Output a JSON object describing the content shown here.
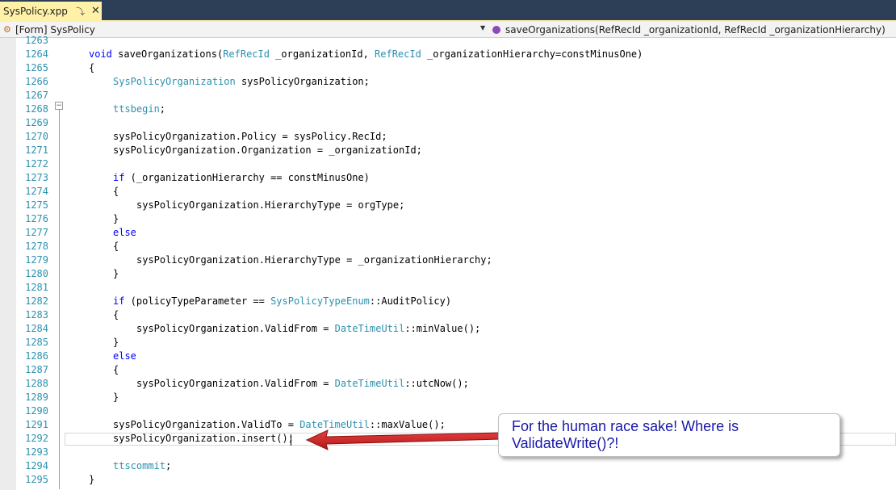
{
  "tab": {
    "title": "SysPolicy.xpp",
    "pin_glyph": "⤵",
    "close_glyph": "✕"
  },
  "navbar": {
    "left_label": "[Form] SysPolicy",
    "right_label": "saveOrganizations(RefRecId _organizationId, RefRecId _organizationHierarchy)"
  },
  "lines": [
    {
      "n": "1263",
      "t": []
    },
    {
      "n": "1264",
      "t": [
        [
          "kw",
          "void"
        ],
        [
          "p",
          " saveOrganizations("
        ],
        [
          "ty",
          "RefRecId"
        ],
        [
          "p",
          " _organizationId, "
        ],
        [
          "ty",
          "RefRecId"
        ],
        [
          "p",
          " _organizationHierarchy=constMinusOne)"
        ]
      ],
      "indent": 1
    },
    {
      "n": "1265",
      "t": [
        [
          "p",
          "{"
        ]
      ],
      "indent": 1
    },
    {
      "n": "1266",
      "t": [
        [
          "ty",
          "SysPolicyOrganization"
        ],
        [
          "p",
          " sysPolicyOrganization;"
        ]
      ],
      "indent": 2
    },
    {
      "n": "1267",
      "t": []
    },
    {
      "n": "1268",
      "t": [
        [
          "ty",
          "ttsbegin"
        ],
        [
          "p",
          ";"
        ]
      ],
      "indent": 2
    },
    {
      "n": "1269",
      "t": []
    },
    {
      "n": "1270",
      "t": [
        [
          "p",
          "sysPolicyOrganization.Policy = sysPolicy.RecId;"
        ]
      ],
      "indent": 2
    },
    {
      "n": "1271",
      "t": [
        [
          "p",
          "sysPolicyOrganization.Organization = _organizationId;"
        ]
      ],
      "indent": 2
    },
    {
      "n": "1272",
      "t": []
    },
    {
      "n": "1273",
      "t": [
        [
          "kw",
          "if"
        ],
        [
          "p",
          " (_organizationHierarchy == constMinusOne)"
        ]
      ],
      "indent": 2
    },
    {
      "n": "1274",
      "t": [
        [
          "p",
          "{"
        ]
      ],
      "indent": 2
    },
    {
      "n": "1275",
      "t": [
        [
          "p",
          "sysPolicyOrganization.HierarchyType = orgType;"
        ]
      ],
      "indent": 3
    },
    {
      "n": "1276",
      "t": [
        [
          "p",
          "}"
        ]
      ],
      "indent": 2
    },
    {
      "n": "1277",
      "t": [
        [
          "kw",
          "else"
        ]
      ],
      "indent": 2
    },
    {
      "n": "1278",
      "t": [
        [
          "p",
          "{"
        ]
      ],
      "indent": 2
    },
    {
      "n": "1279",
      "t": [
        [
          "p",
          "sysPolicyOrganization.HierarchyType = _organizationHierarchy;"
        ]
      ],
      "indent": 3
    },
    {
      "n": "1280",
      "t": [
        [
          "p",
          "}"
        ]
      ],
      "indent": 2
    },
    {
      "n": "1281",
      "t": []
    },
    {
      "n": "1282",
      "t": [
        [
          "kw",
          "if"
        ],
        [
          "p",
          " (policyTypeParameter == "
        ],
        [
          "ty",
          "SysPolicyTypeEnum"
        ],
        [
          "p",
          "::AuditPolicy)"
        ]
      ],
      "indent": 2
    },
    {
      "n": "1283",
      "t": [
        [
          "p",
          "{"
        ]
      ],
      "indent": 2
    },
    {
      "n": "1284",
      "t": [
        [
          "p",
          "sysPolicyOrganization.ValidFrom = "
        ],
        [
          "ty",
          "DateTimeUtil"
        ],
        [
          "p",
          "::minValue();"
        ]
      ],
      "indent": 3
    },
    {
      "n": "1285",
      "t": [
        [
          "p",
          "}"
        ]
      ],
      "indent": 2
    },
    {
      "n": "1286",
      "t": [
        [
          "kw",
          "else"
        ]
      ],
      "indent": 2
    },
    {
      "n": "1287",
      "t": [
        [
          "p",
          "{"
        ]
      ],
      "indent": 2
    },
    {
      "n": "1288",
      "t": [
        [
          "p",
          "sysPolicyOrganization.ValidFrom = "
        ],
        [
          "ty",
          "DateTimeUtil"
        ],
        [
          "p",
          "::utcNow();"
        ]
      ],
      "indent": 3
    },
    {
      "n": "1289",
      "t": [
        [
          "p",
          "}"
        ]
      ],
      "indent": 2
    },
    {
      "n": "1290",
      "t": []
    },
    {
      "n": "1291",
      "t": [
        [
          "p",
          "sysPolicyOrganization.ValidTo = "
        ],
        [
          "ty",
          "DateTimeUtil"
        ],
        [
          "p",
          "::maxValue();"
        ]
      ],
      "indent": 2
    },
    {
      "n": "1292",
      "t": [
        [
          "p",
          "sysPolicyOrganization.insert();"
        ]
      ],
      "indent": 2
    },
    {
      "n": "1293",
      "t": []
    },
    {
      "n": "1294",
      "t": [
        [
          "ty",
          "ttscommit"
        ],
        [
          "p",
          ";"
        ]
      ],
      "indent": 2
    },
    {
      "n": "1295",
      "t": [
        [
          "p",
          "}"
        ]
      ],
      "indent": 1
    }
  ],
  "callout": {
    "text": "For the human race sake! Where is ValidateWrite()?!"
  },
  "colors": {
    "keyword": "#0000ff",
    "type": "#2b91af",
    "arrow": "#d42020",
    "callout_text": "#1a1aa8"
  }
}
